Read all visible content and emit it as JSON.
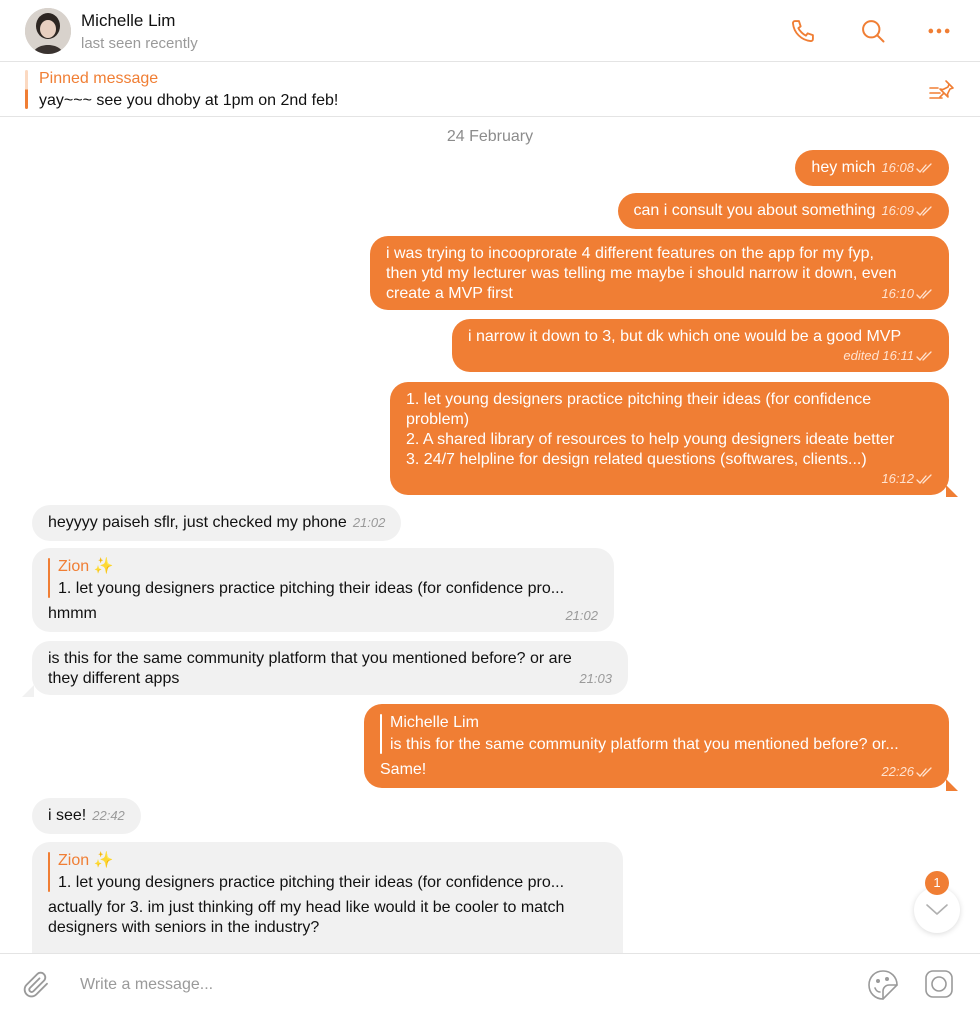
{
  "header": {
    "contact_name": "Michelle Lim",
    "status": "last seen recently",
    "icons": [
      "phone-icon",
      "search-icon",
      "more-icon"
    ]
  },
  "pinned": {
    "title": "Pinned message",
    "text": "yay~~~ see you dhoby at 1pm on 2nd feb!"
  },
  "chat": {
    "date": "24 February",
    "messages": [
      {
        "dir": "out",
        "text": "hey mich",
        "time": "16:08"
      },
      {
        "dir": "out",
        "text": "can i consult you about something",
        "time": "16:09"
      },
      {
        "dir": "out",
        "lines": [
          "i was trying to incooprorate 4 different features on the app for my fyp,",
          "then ytd my lecturer was telling me maybe i should narrow it down, even",
          "create a MVP first"
        ],
        "time": "16:10"
      },
      {
        "dir": "out",
        "text": "i narrow it down to 3, but dk which one would be a good MVP",
        "time": "edited 16:11"
      },
      {
        "dir": "out",
        "lines": [
          "1. let young designers practice pitching their ideas (for confidence",
          "problem)",
          "2. A shared library of resources to help young designers ideate better",
          "3. 24/7 helpline for design related questions (softwares, clients...)"
        ],
        "time": "16:12"
      },
      {
        "dir": "in",
        "text": "heyyyy paiseh sflr, just checked my phone",
        "time": "21:02"
      },
      {
        "dir": "in",
        "reply_name": "Zion ✨",
        "reply_text": "1. let young designers practice pitching their ideas (for confidence pro...",
        "text": "hmmm",
        "time": "21:02"
      },
      {
        "dir": "in",
        "lines": [
          "is this for the same community platform that you mentioned before? or are",
          "they different apps"
        ],
        "time": "21:03"
      },
      {
        "dir": "out",
        "reply_name": "Michelle Lim",
        "reply_text": "is this for the same community platform that you mentioned before? or...",
        "text": "Same!",
        "time": "22:26"
      },
      {
        "dir": "in",
        "text": "i see!",
        "time": "22:42"
      },
      {
        "dir": "in",
        "reply_name": "Zion ✨",
        "reply_text": "1. let young designers practice pitching their ideas (for confidence pro...",
        "lines": [
          "actually for 3. im just thinking off my head like would it be cooler to match",
          "designers with seniors in the industry?"
        ]
      }
    ]
  },
  "unread_count": "1",
  "composer": {
    "placeholder": "Write a message..."
  },
  "colors": {
    "accent": "#f07e34",
    "incoming_bubble": "#f1f1f1"
  }
}
